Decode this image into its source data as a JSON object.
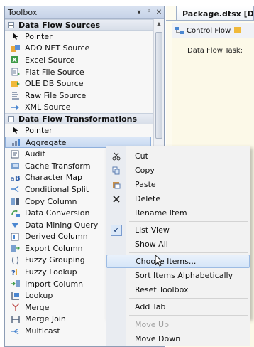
{
  "toolbox": {
    "title": "Toolbox",
    "pin_glyph": "▾ ⊥",
    "close_glyph": "✕",
    "categories": [
      {
        "label": "Data Flow Sources",
        "expander": "⊟",
        "items": [
          {
            "label": "Pointer",
            "icon": "pointer-icon"
          },
          {
            "label": "ADO NET Source",
            "icon": "ado-net-source-icon"
          },
          {
            "label": "Excel Source",
            "icon": "excel-source-icon"
          },
          {
            "label": "Flat File Source",
            "icon": "flat-file-source-icon"
          },
          {
            "label": "OLE DB Source",
            "icon": "ole-db-source-icon"
          },
          {
            "label": "Raw File Source",
            "icon": "raw-file-source-icon"
          },
          {
            "label": "XML Source",
            "icon": "xml-source-icon"
          }
        ]
      },
      {
        "label": "Data Flow Transformations",
        "expander": "⊟",
        "items": [
          {
            "label": "Pointer",
            "icon": "pointer-icon"
          },
          {
            "label": "Aggregate",
            "icon": "aggregate-icon",
            "selected": true
          },
          {
            "label": "Audit",
            "icon": "audit-icon"
          },
          {
            "label": "Cache Transform",
            "icon": "cache-transform-icon"
          },
          {
            "label": "Character Map",
            "icon": "character-map-icon"
          },
          {
            "label": "Conditional Split",
            "icon": "conditional-split-icon"
          },
          {
            "label": "Copy Column",
            "icon": "copy-column-icon"
          },
          {
            "label": "Data Conversion",
            "icon": "data-conversion-icon"
          },
          {
            "label": "Data Mining Query",
            "icon": "data-mining-query-icon"
          },
          {
            "label": "Derived Column",
            "icon": "derived-column-icon"
          },
          {
            "label": "Export Column",
            "icon": "export-column-icon"
          },
          {
            "label": "Fuzzy Grouping",
            "icon": "fuzzy-grouping-icon"
          },
          {
            "label": "Fuzzy Lookup",
            "icon": "fuzzy-lookup-icon"
          },
          {
            "label": "Import Column",
            "icon": "import-column-icon"
          },
          {
            "label": "Lookup",
            "icon": "lookup-icon"
          },
          {
            "label": "Merge",
            "icon": "merge-icon"
          },
          {
            "label": "Merge Join",
            "icon": "merge-join-icon"
          },
          {
            "label": "Multicast",
            "icon": "multicast-icon"
          }
        ]
      }
    ]
  },
  "designer": {
    "doc_tab": "Package.dtsx [De",
    "control_flow_tab": "Control Flow",
    "data_flow_task_label": "Data Flow Task:"
  },
  "context_menu": {
    "items": [
      {
        "label": "Cut",
        "icon": "scissors-icon"
      },
      {
        "label": "Copy",
        "icon": "copy-icon"
      },
      {
        "label": "Paste",
        "icon": "paste-icon"
      },
      {
        "label": "Delete",
        "icon": "delete-icon"
      },
      {
        "label": "Rename Item",
        "icon": ""
      },
      {
        "label": "List View",
        "icon": "checkmark-icon",
        "checked": true
      },
      {
        "label": "Show All",
        "icon": ""
      },
      {
        "label": "Choose Items...",
        "icon": "",
        "hover": true
      },
      {
        "label": "Sort Items Alphabetically",
        "icon": ""
      },
      {
        "label": "Reset Toolbox",
        "icon": ""
      },
      {
        "label": "Add Tab",
        "icon": ""
      },
      {
        "label": "Move Up",
        "icon": "",
        "disabled": true
      },
      {
        "label": "Move Down",
        "icon": ""
      }
    ]
  },
  "colors": {
    "title_bar": "#c5d2e7",
    "category_band": "#d8dfe9",
    "selection": "#c6d8f1",
    "menu_background": "#f2f2f2",
    "designer_background": "#fdfbef"
  }
}
